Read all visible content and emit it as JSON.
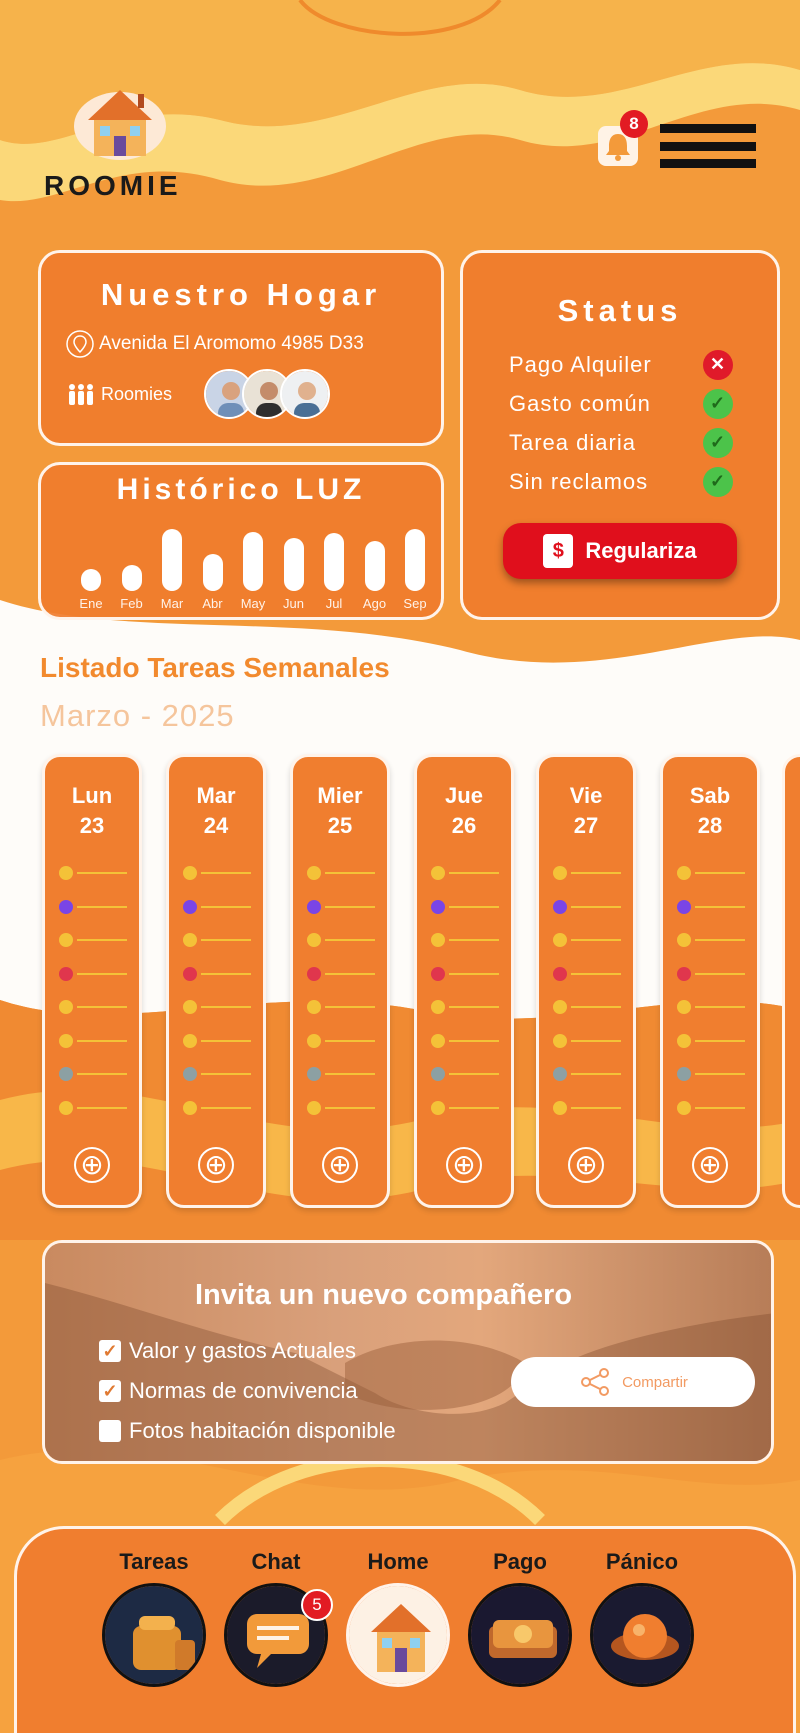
{
  "app": {
    "brand": "ROOMIE",
    "notifications_count": "8",
    "colors": {
      "primary": "#f07e2f",
      "accent_red": "#e00f1c",
      "ok_green": "#4cc34a",
      "task_line": "#f4c238"
    }
  },
  "hogar": {
    "title": "Nuestro Hogar",
    "address": "Avenida El Aromomo 4985 D33",
    "roomies_label": "Roomies"
  },
  "status": {
    "title": "Status",
    "items": [
      {
        "label": "Pago Alquiler",
        "state": "bad",
        "icon": "✕"
      },
      {
        "label": "Gasto común",
        "state": "ok",
        "icon": "✓"
      },
      {
        "label": "Tarea diaria",
        "state": "ok",
        "icon": "✓"
      },
      {
        "label": "Sin reclamos",
        "state": "ok",
        "icon": "✓"
      }
    ],
    "button_label": "Regulariza",
    "button_icon": "$"
  },
  "chart_data": {
    "type": "bar",
    "title": "Histórico LUZ",
    "categories": [
      "Ene",
      "Feb",
      "Mar",
      "Abr",
      "May",
      "Jun",
      "Jul",
      "Ago",
      "Sep"
    ],
    "values": [
      0.35,
      0.42,
      1.0,
      0.6,
      0.95,
      0.85,
      0.93,
      0.8,
      1.0
    ],
    "ylim": [
      0,
      1
    ]
  },
  "tasks": {
    "title": "Listado Tareas Semanales",
    "month": "Marzo - 2025",
    "dot_colors": [
      "#f4c238",
      "#7a45e6",
      "#f4c238",
      "#e0364d",
      "#f4c238",
      "#f4c238",
      "#8ca0a3",
      "#f4c238"
    ],
    "days": [
      {
        "name": "Lun",
        "num": "23"
      },
      {
        "name": "Mar",
        "num": "24"
      },
      {
        "name": "Mier",
        "num": "25"
      },
      {
        "name": "Jue",
        "num": "26"
      },
      {
        "name": "Vie",
        "num": "27"
      },
      {
        "name": "Sab",
        "num": "28"
      }
    ],
    "add_icon": "⊕"
  },
  "invite": {
    "title": "Invita un nuevo compañero",
    "items": [
      {
        "label": "Valor y gastos Actuales",
        "checked": true
      },
      {
        "label": "Normas de convivencia",
        "checked": true
      },
      {
        "label": "Fotos habitación disponible",
        "checked": false
      }
    ],
    "share_label": "Compartir"
  },
  "nav": {
    "items": [
      {
        "label": "Tareas",
        "icon": "mailbox-icon"
      },
      {
        "label": "Chat",
        "icon": "chat-bubble-icon",
        "badge": "5"
      },
      {
        "label": "Home",
        "icon": "house-icon"
      },
      {
        "label": "Pago",
        "icon": "cash-icon"
      },
      {
        "label": "Pánico",
        "icon": "panic-button-icon"
      }
    ]
  }
}
